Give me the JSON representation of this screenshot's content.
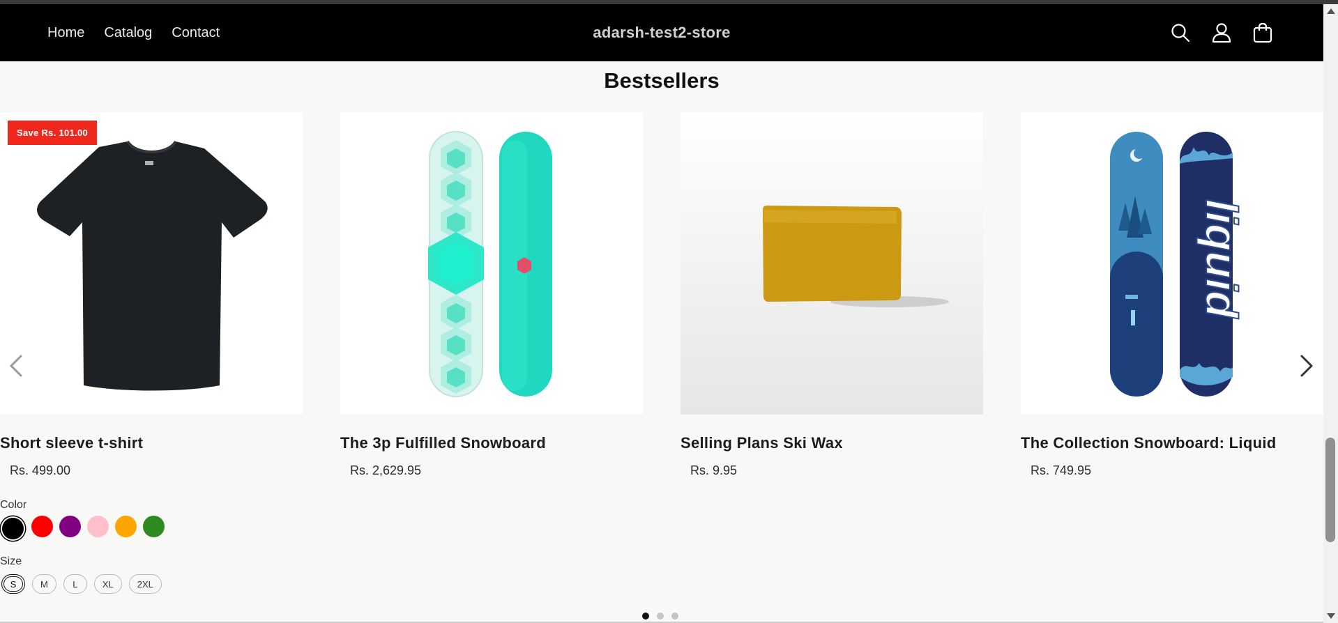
{
  "header": {
    "nav": [
      {
        "label": "Home"
      },
      {
        "label": "Catalog"
      },
      {
        "label": "Contact"
      }
    ],
    "brand": "adarsh-test2-store",
    "icons": [
      "search-icon",
      "account-icon",
      "cart-icon"
    ]
  },
  "section": {
    "title": "Bestsellers"
  },
  "products": [
    {
      "title": "Short sleeve t-shirt",
      "price": "Rs. 499.00",
      "badge": "Save Rs. 101.00",
      "image": "black-tshirt"
    },
    {
      "title": "The 3p Fulfilled Snowboard",
      "price": "Rs. 2,629.95",
      "image": "teal-snowboard"
    },
    {
      "title": "Selling Plans Ski Wax",
      "price": "Rs. 9.95",
      "image": "ski-wax"
    },
    {
      "title": "The Collection Snowboard: Liquid",
      "price": "Rs. 749.95",
      "image": "liquid-snowboard"
    }
  ],
  "options": {
    "color_label": "Color",
    "colors": [
      {
        "name": "black",
        "hex": "#000000",
        "selected": true
      },
      {
        "name": "red",
        "hex": "#ff0000",
        "selected": false
      },
      {
        "name": "purple",
        "hex": "#800080",
        "selected": false
      },
      {
        "name": "pink",
        "hex": "#ffc0cb",
        "selected": false
      },
      {
        "name": "orange",
        "hex": "#ffa500",
        "selected": false
      },
      {
        "name": "green",
        "hex": "#2e8b22",
        "selected": false
      }
    ],
    "size_label": "Size",
    "sizes": [
      {
        "label": "S",
        "selected": true
      },
      {
        "label": "M",
        "selected": false
      },
      {
        "label": "L",
        "selected": false
      },
      {
        "label": "XL",
        "selected": false
      },
      {
        "label": "2XL",
        "selected": false
      }
    ]
  },
  "carousel": {
    "pages": 3,
    "active_page": 1
  },
  "colors": {
    "header_bg": "#000000",
    "page_bg": "#f8f8f6",
    "badge_bg": "#f0271d"
  }
}
